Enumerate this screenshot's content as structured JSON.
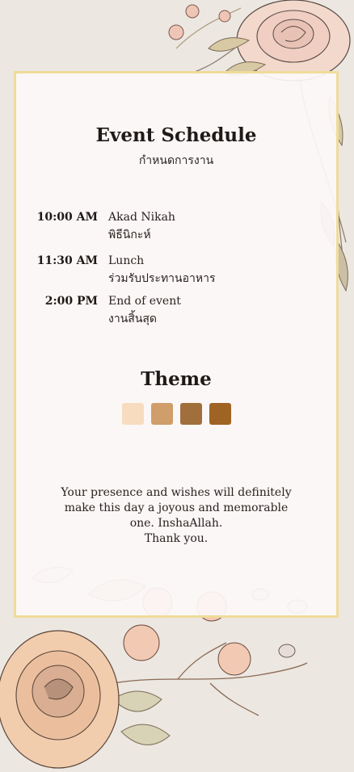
{
  "card": {
    "title": "Event Schedule",
    "subtitle": "กำหนดการงาน"
  },
  "schedule": [
    {
      "time": "10:00 AM",
      "event": "Akad Nikah",
      "event_th": "พิธีนิกะห์"
    },
    {
      "time": "11:30 AM",
      "event": "Lunch",
      "event_th": "ร่วมรับประทานอาหาร"
    },
    {
      "time": "2:00 PM",
      "event": "End of event",
      "event_th": "งานสิ้นสุด"
    }
  ],
  "theme": {
    "title": "Theme",
    "colors": [
      "#f8dcc0",
      "#cf9e6b",
      "#a06f3c",
      "#9f6424"
    ]
  },
  "closing": {
    "line1": "Your presence and wishes will definitely",
    "line2": "make this day a joyous and memorable",
    "line3": "one. InshaAllah.",
    "line4": "Thank you."
  },
  "colors": {
    "background": "#ece7e1",
    "card": "#fcf8f7",
    "border": "#efdc9a"
  }
}
